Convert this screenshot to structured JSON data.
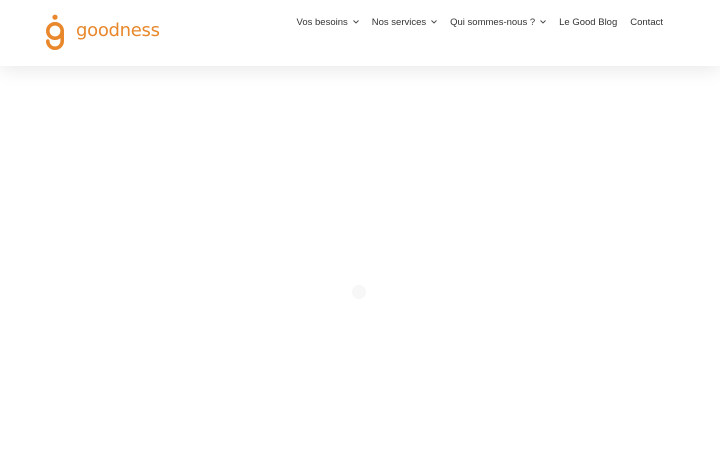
{
  "brand": {
    "name": "goodness",
    "color": "#e8872b"
  },
  "nav": {
    "items": [
      {
        "label": "Vos besoins",
        "has_dropdown": true
      },
      {
        "label": "Nos services",
        "has_dropdown": true
      },
      {
        "label": "Qui sommes-nous ?",
        "has_dropdown": true
      },
      {
        "label": "Le Good Blog",
        "has_dropdown": false
      },
      {
        "label": "Contact",
        "has_dropdown": false
      }
    ],
    "text_color": "#333333"
  },
  "icons": {
    "logo": "goodness-logo-icon",
    "dropdown": "chevron-down-icon"
  }
}
